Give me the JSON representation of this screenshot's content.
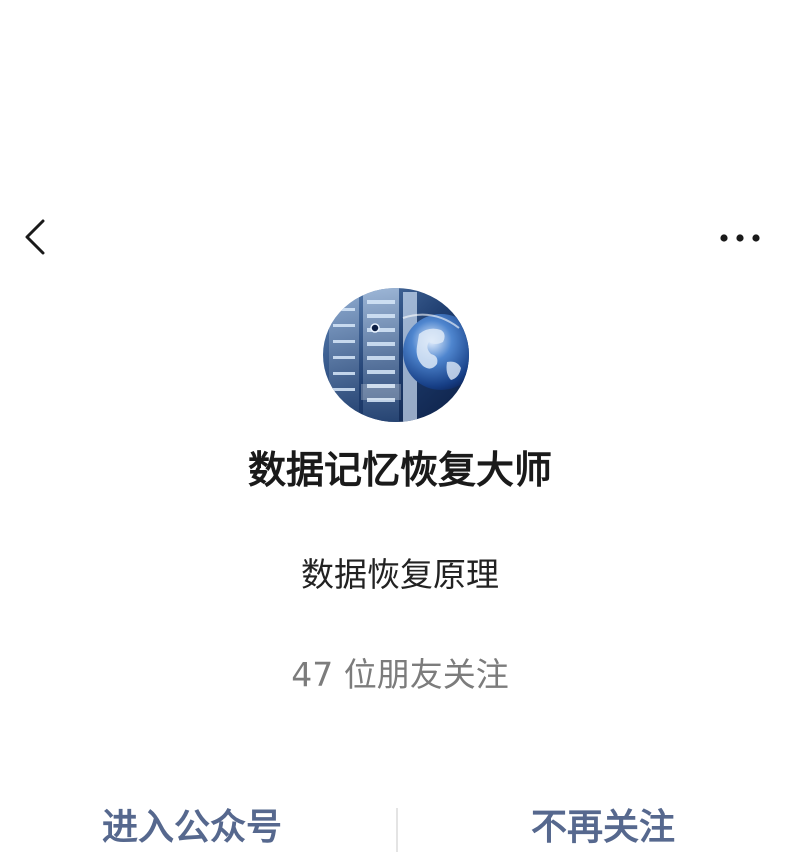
{
  "account": {
    "name": "数据记忆恢复大师",
    "description": "数据恢复原理",
    "followers_text": "47 位朋友关注"
  },
  "actions": {
    "enter_label": "进入公众号",
    "unfollow_label": "不再关注"
  },
  "icons": {
    "back": "chevron-left-icon",
    "more": "more-horizontal-icon"
  },
  "colors": {
    "action_link": "#56688e",
    "secondary_text": "#7c7c7c"
  }
}
